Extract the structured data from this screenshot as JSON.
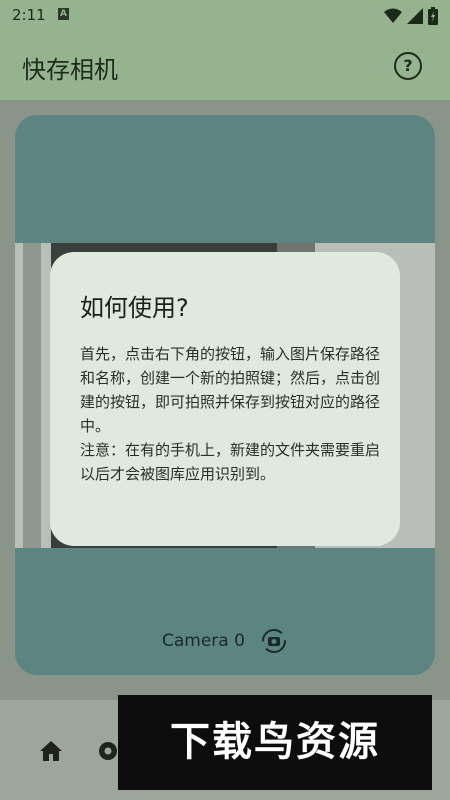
{
  "status_bar": {
    "time": "2:11",
    "icons": [
      "notification-a-icon",
      "wifi-icon",
      "signal-icon",
      "battery-icon"
    ]
  },
  "app_bar": {
    "title": "快存相机",
    "help_icon": "help-icon",
    "help_symbol": "?"
  },
  "camera": {
    "label": "Camera 0",
    "switch_icon": "camera-switch-icon"
  },
  "bottom_nav": {
    "items": [
      "home-icon",
      "gear-icon"
    ]
  },
  "dialog": {
    "title": "如何使用?",
    "body": "首先，点击右下角的按钮，输入图片保存路径和名称，创建一个新的拍照键；然后，点击创建的按钮，即可拍照并保存到按钮对应的路径中。\n注意：在有的手机上，新建的文件夹需要重启以后才会被图库应用识别到。"
  },
  "watermark": {
    "text": "下载鸟资源"
  },
  "colors": {
    "app_bar": "#96b38f",
    "camera_card": "#5c8581",
    "dialog_bg": "#dfe9dd",
    "scrim": "#8a9488"
  }
}
